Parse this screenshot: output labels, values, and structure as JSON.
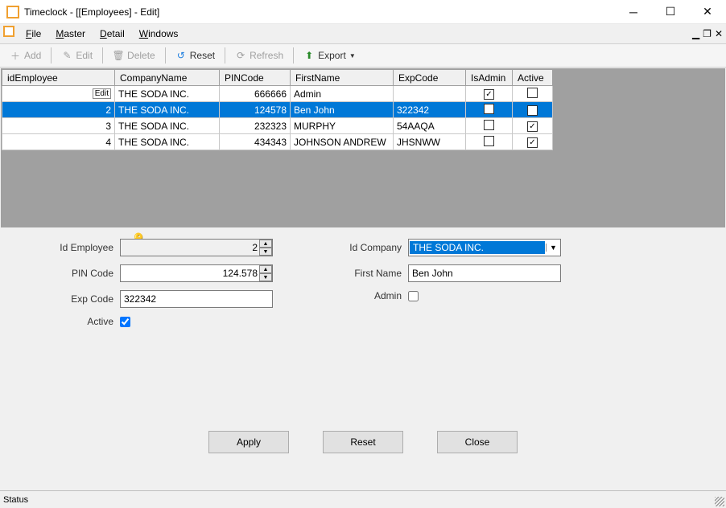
{
  "window": {
    "title": "Timeclock - [[Employees] - Edit]"
  },
  "menubar": {
    "file": "File",
    "master": "Master",
    "detail": "Detail",
    "windows": "Windows"
  },
  "toolbar": {
    "add": "Add",
    "edit": "Edit",
    "delete": "Delete",
    "reset": "Reset",
    "refresh": "Refresh",
    "export": "Export"
  },
  "grid": {
    "headers": {
      "id": "idEmployee",
      "company": "CompanyName",
      "pin": "PINCode",
      "first": "FirstName",
      "exp": "ExpCode",
      "admin": "IsAdmin",
      "active": "Active"
    },
    "rows": [
      {
        "id": "",
        "company": "THE SODA INC.",
        "pin": "666666",
        "first": "Admin",
        "exp": "",
        "admin": true,
        "active": false,
        "editTag": "Edit"
      },
      {
        "id": "2",
        "company": "THE SODA INC.",
        "pin": "124578",
        "first": "Ben John",
        "exp": "322342",
        "admin": false,
        "active": true,
        "selected": true
      },
      {
        "id": "3",
        "company": "THE SODA INC.",
        "pin": "232323",
        "first": "MURPHY",
        "exp": "54AAQA",
        "admin": false,
        "active": true
      },
      {
        "id": "4",
        "company": "THE SODA INC.",
        "pin": "434343",
        "first": "JOHNSON ANDREW",
        "exp": "JHSNWW",
        "admin": false,
        "active": true
      }
    ]
  },
  "form": {
    "labels": {
      "idEmployee": "Id Employee",
      "pinCode": "PIN Code",
      "expCode": "Exp Code",
      "active": "Active",
      "idCompany": "Id Company",
      "firstName": "First Name",
      "admin": "Admin"
    },
    "values": {
      "idEmployee": "2",
      "pinCode": "124.578",
      "expCode": "322342",
      "active": true,
      "idCompany": "THE SODA INC.",
      "firstName": "Ben John",
      "admin": false
    }
  },
  "buttons": {
    "apply": "Apply",
    "reset": "Reset",
    "close": "Close"
  },
  "status": "Status"
}
